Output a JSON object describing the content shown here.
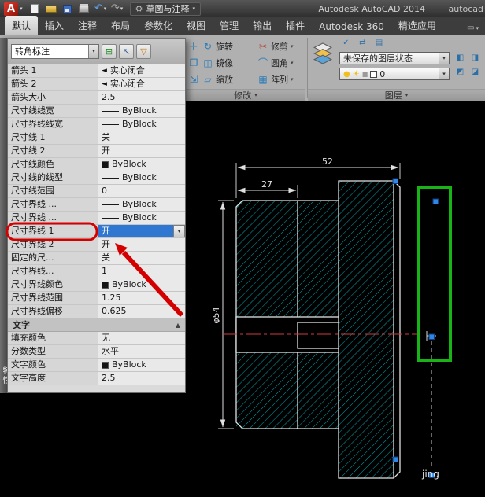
{
  "colors": {
    "highlight_green": "#17b317",
    "annotation_red": "#d40000",
    "selection_blue": "#2f77d0",
    "hatch_cyan": "#00a6ad",
    "centerline_red": "#cf3b3b",
    "grip_blue": "#2e86e8"
  },
  "titlebar": {
    "logo_letter": "A",
    "app_title": "Autodesk AutoCAD 2014",
    "doc_title": "autocad",
    "workspace": "草图与注释"
  },
  "ribbon": {
    "tabs": [
      {
        "label": "默认",
        "active": true
      },
      {
        "label": "插入"
      },
      {
        "label": "注释"
      },
      {
        "label": "布局"
      },
      {
        "label": "参数化"
      },
      {
        "label": "视图"
      },
      {
        "label": "管理"
      },
      {
        "label": "输出"
      },
      {
        "label": "插件"
      },
      {
        "label": "Autodesk 360"
      },
      {
        "label": "精选应用"
      }
    ],
    "modify_panel": {
      "title": "修改",
      "tools": [
        {
          "name": "move",
          "label": ""
        },
        {
          "name": "rotate",
          "label": "旋转"
        },
        {
          "name": "trim",
          "label": "修剪",
          "dd": true
        },
        {
          "name": "copy",
          "label": ""
        },
        {
          "name": "mirror",
          "label": "镜像"
        },
        {
          "name": "fillet",
          "label": "圆角",
          "dd": true
        },
        {
          "name": "stretch",
          "label": ""
        },
        {
          "name": "scale",
          "label": "缩放"
        },
        {
          "name": "array",
          "label": "阵列",
          "dd": true
        }
      ]
    },
    "layers_panel": {
      "title": "图层",
      "layer_state_value": "未保存的图层状态",
      "current_layer": "0"
    }
  },
  "palette": {
    "title": "特性",
    "type_selector": "转角标注",
    "rows": [
      {
        "label": "箭头 1",
        "value": "实心闭合",
        "kind": "arrow"
      },
      {
        "label": "箭头 2",
        "value": "实心闭合",
        "kind": "arrow"
      },
      {
        "label": "箭头大小",
        "value": "2.5",
        "kind": "text"
      },
      {
        "label": "尺寸线线宽",
        "value": "ByBlock",
        "kind": "line"
      },
      {
        "label": "尺寸界线线宽",
        "value": "ByBlock",
        "kind": "line"
      },
      {
        "label": "尺寸线 1",
        "value": "关",
        "kind": "text"
      },
      {
        "label": "尺寸线 2",
        "value": "开",
        "kind": "text"
      },
      {
        "label": "尺寸线颜色",
        "value": "ByBlock",
        "kind": "color"
      },
      {
        "label": "尺寸线的线型",
        "value": "ByBlock",
        "kind": "line"
      },
      {
        "label": "尺寸线范围",
        "value": "0",
        "kind": "text"
      },
      {
        "label": "尺寸界线 ...",
        "value": "ByBlock",
        "kind": "line"
      },
      {
        "label": "尺寸界线 ...",
        "value": "ByBlock",
        "kind": "line"
      },
      {
        "label": "尺寸界线 1",
        "value": "开",
        "kind": "dropdown",
        "highlighted": true
      },
      {
        "label": "尺寸界线 2",
        "value": "开",
        "kind": "text"
      },
      {
        "label": "固定的尺...",
        "value": "关",
        "kind": "text"
      },
      {
        "label": "尺寸界线...",
        "value": "1",
        "kind": "text"
      },
      {
        "label": "尺寸界线颜色",
        "value": "ByBlock",
        "kind": "color"
      },
      {
        "label": "尺寸界线范围",
        "value": "1.25",
        "kind": "text"
      },
      {
        "label": "尺寸界线偏移",
        "value": "0.625",
        "kind": "text"
      },
      {
        "header": "文字"
      },
      {
        "label": "填充颜色",
        "value": "无",
        "kind": "text"
      },
      {
        "label": "分数类型",
        "value": "水平",
        "kind": "text"
      },
      {
        "label": "文字颜色",
        "value": "ByBlock",
        "kind": "color"
      },
      {
        "label": "文字高度",
        "value": "2.5",
        "kind": "text"
      }
    ]
  },
  "drawing": {
    "dim_top": "52",
    "dim_inner": "27",
    "dim_diameter": "φ54",
    "watermark": "jing"
  }
}
